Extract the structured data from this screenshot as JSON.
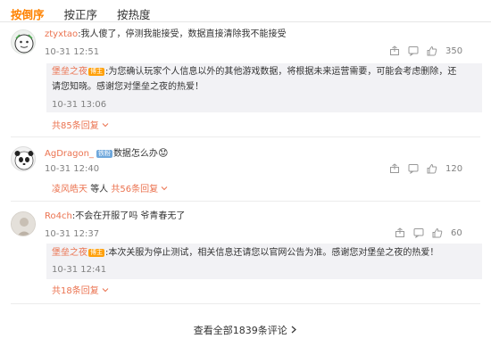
{
  "tabs": [
    {
      "label": "按倒序",
      "active": true
    },
    {
      "label": "按正序",
      "active": false
    },
    {
      "label": "按热度",
      "active": false
    }
  ],
  "comments": [
    {
      "user": "ztyxtao",
      "text": ":我人傻了，停测我能接受，数据直接清除我不能接受",
      "time": "10-31 12:51",
      "likes": "350",
      "reply": {
        "user": "堡垒之夜",
        "badge": "博主",
        "text_line1": ":为您确认玩家个人信息以外的其他游戏数据，将根据未来运营需要，可能会考虑删除，还",
        "text_line2": "请您知晓。感谢您对堡垒之夜的热爱！",
        "time": "10-31 13:06"
      },
      "reply_count_label": "共85条回复"
    },
    {
      "user": "AgDragon_",
      "badge": "铁粉",
      "text": "数据怎么办",
      "emoji": "😟",
      "time": "10-31 12:40",
      "likes": "120",
      "sub_user": "凌风皓天",
      "sub_middle": "等人",
      "reply_count_label": "共56条回复"
    },
    {
      "user": "Ro4ch",
      "text": ":不会在开服了吗 爷青春无了",
      "time": "10-31 12:37",
      "likes": "60",
      "reply": {
        "user": "堡垒之夜",
        "badge": "博主",
        "text_line1": ":本次关服为停止测试，相关信息还请您以官网公告为准。感谢您对堡垒之夜的热爱！",
        "time": "10-31 12:41"
      },
      "reply_count_label": "共18条回复"
    }
  ],
  "footer": {
    "label": "查看全部1839条评论"
  },
  "colors": {
    "accent": "#ff8200",
    "link": "#eb7350",
    "badge_owner": "#ffa00a",
    "badge_iron": "#6fa8dc"
  }
}
